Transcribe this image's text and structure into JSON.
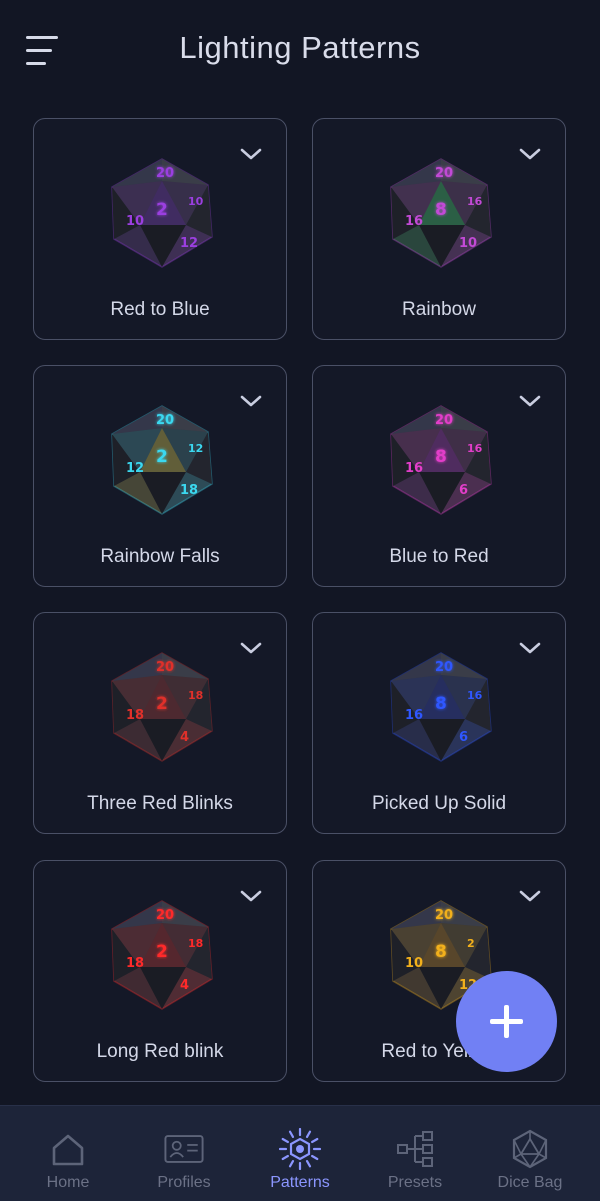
{
  "header": {
    "title": "Lighting Patterns",
    "menu_icon": "hamburger-menu-icon"
  },
  "patterns": [
    {
      "label": "Red to Blue",
      "glow": "#9b3fe0",
      "glow2": "#7a2cd0",
      "numbers": [
        "20",
        "2",
        "10",
        "12",
        "10"
      ]
    },
    {
      "label": "Rainbow",
      "glow": "#c24ad6",
      "glow2": "#2ee36a",
      "numbers": [
        "20",
        "8",
        "16",
        "10",
        "16"
      ]
    },
    {
      "label": "Rainbow Falls",
      "glow": "#3bd8f0",
      "glow2": "#f0e040",
      "numbers": [
        "20",
        "2",
        "12",
        "18",
        "12"
      ]
    },
    {
      "label": "Blue to Red",
      "glow": "#e23ec9",
      "glow2": "#b02cc8",
      "numbers": [
        "20",
        "8",
        "16",
        "6",
        "16"
      ]
    },
    {
      "label": "Three Red Blinks",
      "glow": "#e0302a",
      "glow2": "#a82020",
      "numbers": [
        "20",
        "2",
        "18",
        "4",
        "18"
      ]
    },
    {
      "label": "Picked Up Solid",
      "glow": "#2f57ff",
      "glow2": "#1c34c8",
      "numbers": [
        "20",
        "8",
        "16",
        "6",
        "16"
      ]
    },
    {
      "label": "Long Red blink",
      "glow": "#ff2a2a",
      "glow2": "#c41a1a",
      "numbers": [
        "20",
        "2",
        "18",
        "4",
        "18"
      ]
    },
    {
      "label": "Red to Yellow",
      "glow": "#f2b01c",
      "glow2": "#d08a10",
      "numbers": [
        "20",
        "8",
        "10",
        "12",
        "2"
      ]
    }
  ],
  "fab": {
    "icon": "plus-icon"
  },
  "nav": [
    {
      "label": "Home",
      "icon": "home-icon",
      "active": false
    },
    {
      "label": "Profiles",
      "icon": "id-card-icon",
      "active": false
    },
    {
      "label": "Patterns",
      "icon": "sun-burst-icon",
      "active": true
    },
    {
      "label": "Presets",
      "icon": "hierarchy-icon",
      "active": false
    },
    {
      "label": "Dice Bag",
      "icon": "d20-icon",
      "active": false
    }
  ],
  "colors": {
    "background": "#121624",
    "accent": "#7180f4",
    "nav_active": "#8b96ff",
    "nav_inactive": "#6b7186"
  }
}
